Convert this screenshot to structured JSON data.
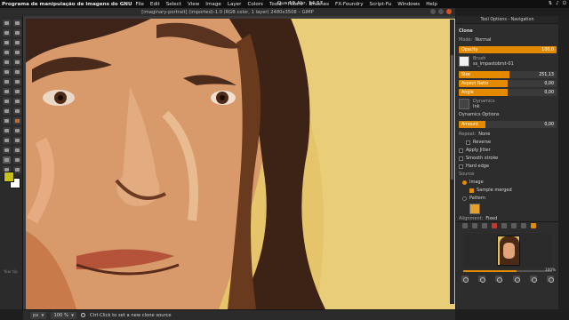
{
  "topbar": {
    "menus": [
      "Programa de manipulação de imagens do GNU",
      "File",
      "Edit",
      "Select",
      "View",
      "Image",
      "Layer",
      "Colors",
      "Tools",
      "Filters",
      "Brushes",
      "FX-Foundry",
      "Script-Fu",
      "Windows",
      "Help"
    ],
    "clock": "Qua 19 Abr, 14:57"
  },
  "window": {
    "title": "[imaginary-portrait] (imported)-1.0 (RGB color, 1 layer) 2480x3508 – GIMP"
  },
  "tool_options": {
    "dock_title": "Tool Options - Navigation",
    "tool_name": "Clone",
    "mode_label": "Mode:",
    "mode_value": "Normal",
    "opacity_label": "Opacity",
    "opacity_value": "100,0",
    "opacity_fraction": 1.0,
    "brush_label": "Brush",
    "brush_name": "ss_impastobrst-01",
    "size_label": "Size",
    "size_value": "251,13",
    "size_fraction": 0.52,
    "aspect_label": "Aspect Ratio",
    "aspect_value": "0,00",
    "aspect_fraction": 0.5,
    "angle_label": "Angle",
    "angle_value": "0,00",
    "angle_fraction": 0.5,
    "dynamics_label": "Dynamics",
    "dynamics_name": "Ink",
    "dynamics_options": "Dynamics Options",
    "fade_label": "Apply Jitter",
    "jitter_amount_label": "Amount",
    "jitter_amount_value": "0,00",
    "smooth_label": "Smooth stroke",
    "hard_edge_label": "Hard edge",
    "source_label": "Source",
    "source_image": "Image",
    "sample_merged": "Sample merged",
    "source_pattern": "Pattern",
    "repeat_label": "Repeat:",
    "repeat_value": "None",
    "reverse_label": "Reverse",
    "alignment_label": "Alignment:",
    "alignment_value": "Fixed"
  },
  "navigation": {
    "zoom_value": "100%",
    "zoom_fraction": 0.6
  },
  "statusbar": {
    "unit": "px",
    "zoom": "100 %",
    "message": "Ctrl-Click to set a new clone source"
  },
  "toolbox": {
    "hint": "Your tip"
  },
  "colors": {
    "accent": "#e38a00",
    "foreground": "#c6c11b",
    "background": "#ffffff",
    "canvas": "#e8c86c"
  }
}
